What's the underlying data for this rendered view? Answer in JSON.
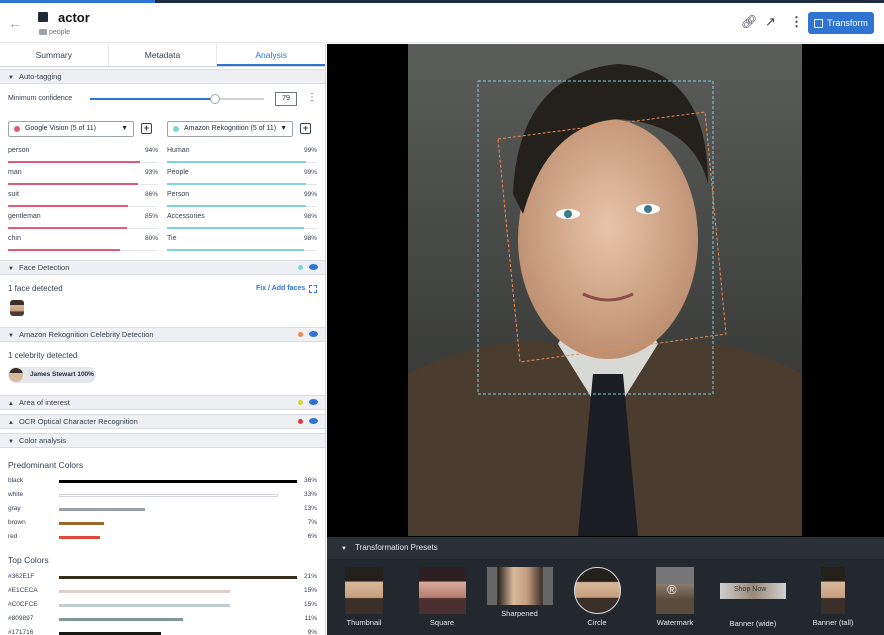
{
  "header": {
    "title": "actor",
    "breadcrumb": "people",
    "transform_label": "Transform"
  },
  "tabs": [
    "Summary",
    "Metadata",
    "Analysis"
  ],
  "auto_tagging": {
    "section_title": "Auto-tagging",
    "min_confidence_label": "Minimum confidence",
    "min_confidence_value": "79",
    "slider_fraction": 0.79,
    "providers": [
      {
        "label": "Google Vision (5 of 11)",
        "color": "#e05a7a"
      },
      {
        "label": "Amazon Rekognition (5 of 11)",
        "color": "#7fd3e0"
      }
    ],
    "google_tags": [
      {
        "name": "person",
        "pct": "94%",
        "value": 0.94
      },
      {
        "name": "man",
        "pct": "93%",
        "value": 0.93
      },
      {
        "name": "suit",
        "pct": "86%",
        "value": 0.86
      },
      {
        "name": "gentleman",
        "pct": "85%",
        "value": 0.85
      },
      {
        "name": "chin",
        "pct": "80%",
        "value": 0.8
      }
    ],
    "amazon_tags": [
      {
        "name": "Human",
        "pct": "99%",
        "value": 0.99
      },
      {
        "name": "People",
        "pct": "99%",
        "value": 0.99
      },
      {
        "name": "Person",
        "pct": "99%",
        "value": 0.99
      },
      {
        "name": "Accessories",
        "pct": "98%",
        "value": 0.98
      },
      {
        "name": "Tie",
        "pct": "98%",
        "value": 0.98
      }
    ]
  },
  "face_detection": {
    "section_title": "Face Detection",
    "status": "1 face detected",
    "fix_link": "Fix / Add faces",
    "dot_color": "#7fd3e0"
  },
  "celebrity": {
    "section_title": "Amazon Rekognition Celebrity Detection",
    "status": "1 celebrity detected",
    "chip": "James Stewart 100%",
    "dot_color": "#f08a4b"
  },
  "area_of_interest": {
    "section_title": "Area of interest",
    "dot_color": "#d7d23a"
  },
  "ocr": {
    "section_title": "OCR Optical Character Recognition",
    "dot_color": "#e03a3a"
  },
  "color_analysis": {
    "section_title": "Color analysis",
    "predominant_title": "Predominant Colors",
    "predominant": [
      {
        "name": "black",
        "pct": "36%",
        "value": 1.0,
        "color": "#000000"
      },
      {
        "name": "white",
        "pct": "33%",
        "value": 0.92,
        "color": "#ffffff"
      },
      {
        "name": "gray",
        "pct": "13%",
        "value": 0.36,
        "color": "#9aa1a8"
      },
      {
        "name": "brown",
        "pct": "7%",
        "value": 0.19,
        "color": "#9a6a2a"
      },
      {
        "name": "red",
        "pct": "6%",
        "value": 0.17,
        "color": "#e04a3a"
      }
    ],
    "top_title": "Top Colors",
    "top": [
      {
        "name": "#362E1F",
        "pct": "21%",
        "value": 1.0,
        "color": "#362E1F"
      },
      {
        "name": "#E1CECA",
        "pct": "15%",
        "value": 0.72,
        "color": "#E1CECA"
      },
      {
        "name": "#C0CFCE",
        "pct": "15%",
        "value": 0.72,
        "color": "#C0CFCE"
      },
      {
        "name": "#809897",
        "pct": "11%",
        "value": 0.52,
        "color": "#809897"
      },
      {
        "name": "#171716",
        "pct": "9%",
        "value": 0.43,
        "color": "#171716"
      }
    ]
  },
  "presets": {
    "title": "Transformation Presets",
    "items": [
      "Thumbnail",
      "Square",
      "Sharpened",
      "Circle",
      "Watermark",
      "Banner (wide)",
      "Banner (tall)"
    ],
    "banner_text": "Shop Now"
  }
}
